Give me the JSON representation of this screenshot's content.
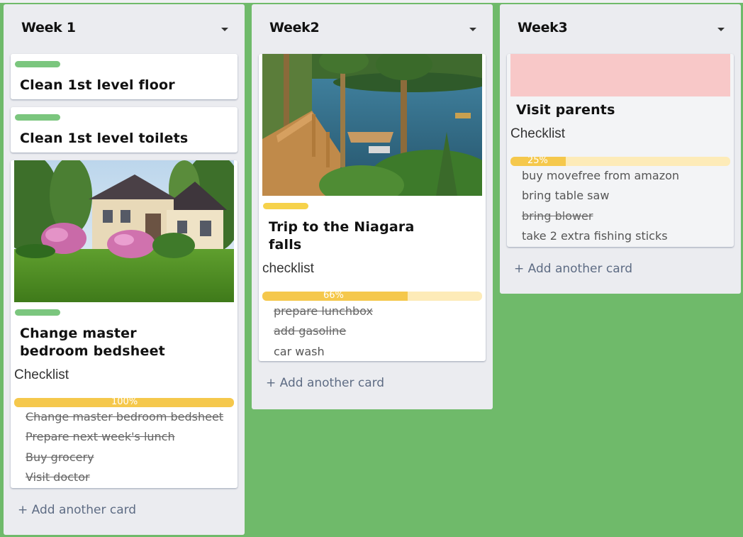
{
  "colors": {
    "board_bg": "#6fba6a",
    "list_bg": "#ebecf0",
    "label_green": "#7bc67e",
    "label_yellow": "#f6d24b",
    "cover_pink": "#f8c8c8",
    "progress_fill": "#f5c84c",
    "progress_track": "#fdebb8"
  },
  "lists": [
    {
      "title": "Week 1",
      "add_card": "+ Add another card",
      "cards": [
        {
          "title": "Clean 1st level floor",
          "label": "green"
        },
        {
          "title": "Clean 1st level toilets",
          "label": "green"
        },
        {
          "cover": "house-photo",
          "label": "green",
          "title_line1": "Change master",
          "title_line2": "bedroom bedsheet",
          "checklist_title": "Checklist",
          "progress_text": "100%",
          "progress": 1.0,
          "items": [
            {
              "text": "Change master bedroom bedsheet",
              "done": true
            },
            {
              "text": "Prepare next week's lunch",
              "done": true
            },
            {
              "text": "Buy grocery",
              "done": true
            },
            {
              "text": "Visit doctor",
              "done": true
            }
          ]
        }
      ]
    },
    {
      "title": "Week2",
      "add_card": "+ Add another card",
      "cards": [
        {
          "cover": "lake-photo",
          "label": "yellow",
          "title_line1": "Trip to the Niagara",
          "title_line2": "falls",
          "checklist_title": "checklist",
          "progress_text": "66%",
          "progress": 0.66,
          "items": [
            {
              "text": "prepare lunchbox",
              "done": true
            },
            {
              "text": "add gasoline",
              "done": true
            },
            {
              "text": "car wash",
              "done": false
            }
          ]
        }
      ]
    },
    {
      "title": "Week3",
      "add_card": "+ Add another card",
      "cards": [
        {
          "cover": "pink-color-cover",
          "title_line1": "Visit parents",
          "checklist_title": "Checklist",
          "progress_text": "25%",
          "progress": 0.25,
          "items": [
            {
              "text": "buy movefree from amazon",
              "done": false
            },
            {
              "text": "bring table saw",
              "done": false
            },
            {
              "text": "bring blower",
              "done": true
            },
            {
              "text": "take 2 extra fishing sticks",
              "done": false
            }
          ]
        }
      ]
    }
  ]
}
